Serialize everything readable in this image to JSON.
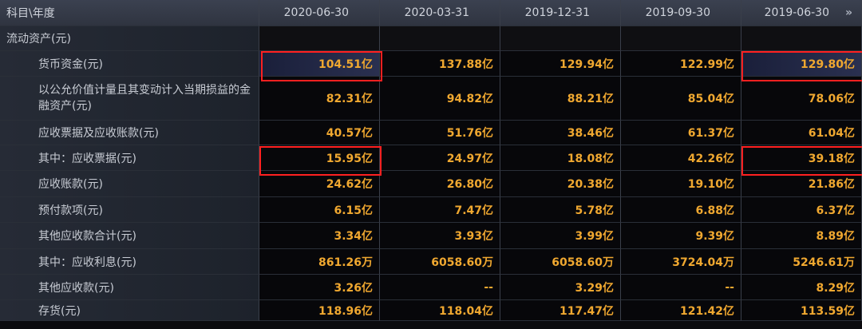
{
  "header": {
    "corner": "科目\\年度",
    "dates": [
      "2020-06-30",
      "2020-03-31",
      "2019-12-31",
      "2019-09-30",
      "2019-06-30"
    ],
    "scroll_icon": "chevron-double-right-icon"
  },
  "section_title": "流动资产(元)",
  "rows": [
    {
      "label": "货币资金(元)",
      "values": [
        "104.51亿",
        "137.88亿",
        "129.94亿",
        "122.99亿",
        "129.80亿"
      ]
    },
    {
      "label": "以公允价值计量且其变动计入当期损益的金融资产(元)",
      "values": [
        "82.31亿",
        "94.82亿",
        "88.21亿",
        "85.04亿",
        "78.06亿"
      ]
    },
    {
      "label": "应收票据及应收账款(元)",
      "values": [
        "40.57亿",
        "51.76亿",
        "38.46亿",
        "61.37亿",
        "61.04亿"
      ]
    },
    {
      "label": "其中：应收票据(元)",
      "values": [
        "15.95亿",
        "24.97亿",
        "18.08亿",
        "42.26亿",
        "39.18亿"
      ]
    },
    {
      "label": "应收账款(元)",
      "values": [
        "24.62亿",
        "26.80亿",
        "20.38亿",
        "19.10亿",
        "21.86亿"
      ]
    },
    {
      "label": "预付款项(元)",
      "values": [
        "6.15亿",
        "7.47亿",
        "5.78亿",
        "6.88亿",
        "6.37亿"
      ]
    },
    {
      "label": "其他应收款合计(元)",
      "values": [
        "3.34亿",
        "3.93亿",
        "3.99亿",
        "9.39亿",
        "8.89亿"
      ]
    },
    {
      "label": "其中：应收利息(元)",
      "values": [
        "861.26万",
        "6058.60万",
        "6058.60万",
        "3724.04万",
        "5246.61万"
      ]
    },
    {
      "label": "其他应收款(元)",
      "values": [
        "3.26亿",
        "--",
        "3.29亿",
        "--",
        "8.29亿"
      ]
    },
    {
      "label": "存货(元)",
      "values": [
        "118.96亿",
        "118.04亿",
        "117.47亿",
        "121.42亿",
        "113.59亿"
      ]
    }
  ],
  "colors": {
    "value": "#f0a830",
    "highlight_box": "#ff2020",
    "header_bg": "#353a46"
  }
}
